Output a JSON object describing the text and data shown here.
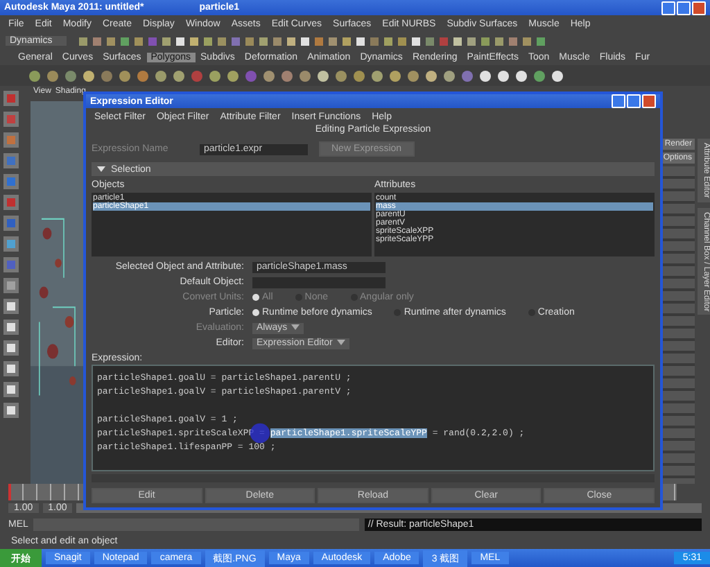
{
  "window": {
    "title": "Autodesk Maya 2011: untitled*",
    "subtitle": "particle1"
  },
  "menu": [
    "File",
    "Edit",
    "Modify",
    "Create",
    "Display",
    "Window",
    "Assets",
    "Edit Curves",
    "Surfaces",
    "Edit NURBS",
    "Subdiv Surfaces",
    "Muscle",
    "Help"
  ],
  "status_line": {
    "mode": "Dynamics"
  },
  "shelf_tabs": [
    {
      "label": "General",
      "selected": false
    },
    {
      "label": "Curves",
      "selected": false
    },
    {
      "label": "Surfaces",
      "selected": false
    },
    {
      "label": "Polygons",
      "selected": true
    },
    {
      "label": "Subdivs",
      "selected": false
    },
    {
      "label": "Deformation",
      "selected": false
    },
    {
      "label": "Animation",
      "selected": false
    },
    {
      "label": "Dynamics",
      "selected": false
    },
    {
      "label": "Rendering",
      "selected": false
    },
    {
      "label": "PaintEffects",
      "selected": false
    },
    {
      "label": "Toon",
      "selected": false
    },
    {
      "label": "Muscle",
      "selected": false
    },
    {
      "label": "Fluids",
      "selected": false
    },
    {
      "label": "Fur",
      "selected": false
    }
  ],
  "viewport": {
    "menu": [
      "View",
      "Shading"
    ]
  },
  "dialog": {
    "title": "Expression Editor",
    "menu": [
      "Select Filter",
      "Object Filter",
      "Attribute Filter",
      "Insert Functions",
      "Help"
    ],
    "heading": "Editing Particle Expression",
    "name_label": "Expression Name",
    "name_value": "particle1.expr",
    "new_button": "New Expression",
    "section": "Selection",
    "section_expanded": true,
    "objects_label": "Objects",
    "objects": [
      {
        "label": "particle1",
        "selected": false
      },
      {
        "label": "particleShape1",
        "selected": true
      }
    ],
    "attributes_label": "Attributes",
    "attributes": [
      {
        "label": "count",
        "selected": false
      },
      {
        "label": "mass",
        "selected": true
      },
      {
        "label": "parentU",
        "selected": false
      },
      {
        "label": "parentV",
        "selected": false
      },
      {
        "label": "spriteScaleXPP",
        "selected": false
      },
      {
        "label": "spriteScaleYPP",
        "selected": false
      }
    ],
    "fields": [
      {
        "kind": "text",
        "label": "Selected Object and Attribute:",
        "value": "particleShape1.mass",
        "disabled": false
      },
      {
        "kind": "text",
        "label": "Default Object:",
        "disabled": false
      },
      {
        "kind": "radio",
        "label": "Convert Units:",
        "disabled": true,
        "options": [
          {
            "label": "All",
            "selected": true
          },
          {
            "label": "None",
            "selected": false
          },
          {
            "label": "Angular only",
            "selected": false
          }
        ]
      },
      {
        "kind": "radio",
        "label": "Particle:",
        "disabled": false,
        "options": [
          {
            "label": "Runtime before dynamics",
            "selected": true
          },
          {
            "label": "Runtime after dynamics",
            "selected": false
          },
          {
            "label": "Creation",
            "selected": false
          }
        ]
      },
      {
        "kind": "dropdown",
        "label": "Evaluation:",
        "value": "Always",
        "disabled": true
      },
      {
        "kind": "dropdown",
        "label": "Editor:",
        "value": "Expression Editor",
        "disabled": false
      }
    ],
    "expression_label": "Expression:",
    "code": [
      {
        "kind": "code",
        "parts": [
          {
            "text": "particleShape1.goalU = particleShape1.parentU ;",
            "selected": false
          }
        ]
      },
      {
        "kind": "code",
        "parts": [
          {
            "text": "particleShape1.goalV = particleShape1.parentV ;",
            "selected": false
          }
        ]
      },
      {
        "kind": "blank"
      },
      {
        "kind": "code",
        "parts": [
          {
            "text": "particleShape1.goalV = 1 ;",
            "selected": false
          }
        ]
      },
      {
        "kind": "code",
        "parts": [
          {
            "text": "particleShape1.spriteScaleXPP = ",
            "selected": false
          },
          {
            "text": "particleShape1.spriteScaleYPP",
            "selected": true
          },
          {
            "text": " = rand(0.2,2.0) ;",
            "selected": false
          }
        ]
      },
      {
        "kind": "code",
        "parts": [
          {
            "text": "particleShape1.lifespanPP = 100 ;",
            "selected": false
          }
        ]
      }
    ],
    "buttons": [
      "Edit",
      "Delete",
      "Reload",
      "Clear",
      "Close"
    ]
  },
  "side_tabs": [
    "Attribute Editor",
    "Channel Box / Layer Editor"
  ],
  "side_buttons": [
    "Render",
    "Options"
  ],
  "time_slider": {
    "level": 0
  },
  "range_slider": {
    "level": 1
  },
  "range": [
    "1.00",
    "1.00"
  ],
  "command_line": {
    "label": "MEL",
    "result": "// Result: particleShape1"
  },
  "help_line": "Select and edit an object",
  "taskbar": {
    "start": "开始",
    "items": [
      "Snagit",
      "Notepad",
      "camera",
      "截图.PNG",
      "Maya",
      "Autodesk",
      "Adobe",
      "3 截图",
      "MEL"
    ],
    "clock": "5:31"
  }
}
